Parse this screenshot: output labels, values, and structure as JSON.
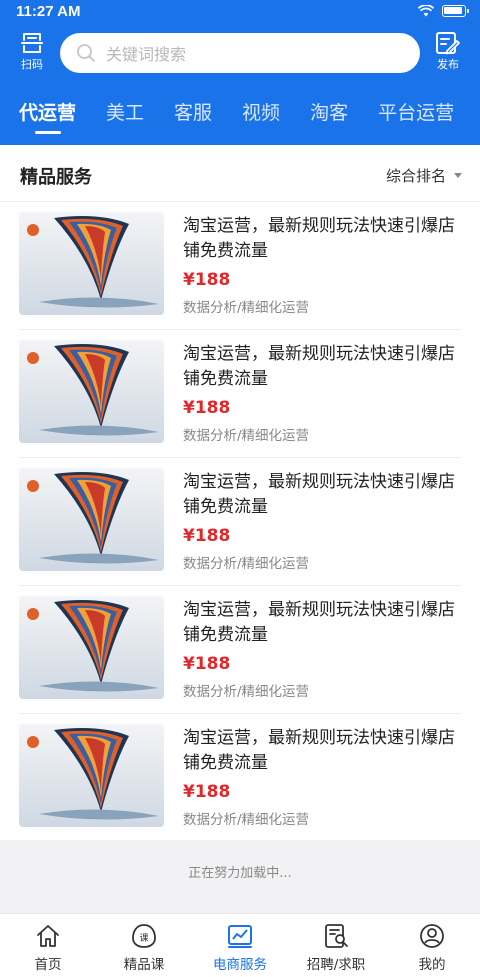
{
  "status_bar": {
    "time": "11:27 AM"
  },
  "header": {
    "scan_label": "扫码",
    "publish_label": "发布",
    "search": {
      "placeholder": "关键词搜索"
    },
    "tabs": [
      {
        "label": "代运营",
        "active": true
      },
      {
        "label": "美工"
      },
      {
        "label": "客服"
      },
      {
        "label": "视频"
      },
      {
        "label": "淘客"
      },
      {
        "label": "平台运营"
      }
    ]
  },
  "section": {
    "title": "精品服务",
    "sort_label": "综合排名"
  },
  "items": [
    {
      "title": "淘宝运营，最新规则玩法快速引爆店铺免费流量",
      "price": "¥188",
      "tags": "数据分析/精细化运营"
    },
    {
      "title": "淘宝运营，最新规则玩法快速引爆店铺免费流量",
      "price": "¥188",
      "tags": "数据分析/精细化运营"
    },
    {
      "title": "淘宝运营，最新规则玩法快速引爆店铺免费流量",
      "price": "¥188",
      "tags": "数据分析/精细化运营"
    },
    {
      "title": "淘宝运营，最新规则玩法快速引爆店铺免费流量",
      "price": "¥188",
      "tags": "数据分析/精细化运营"
    },
    {
      "title": "淘宝运营，最新规则玩法快速引爆店铺免费流量",
      "price": "¥188",
      "tags": "数据分析/精细化运营"
    }
  ],
  "loading_text": "正在努力加载中...",
  "tabbar": [
    {
      "label": "首页",
      "icon": "home-icon"
    },
    {
      "label": "精品课",
      "icon": "course-icon"
    },
    {
      "label": "电商服务",
      "icon": "ecommerce-icon",
      "active": true
    },
    {
      "label": "招聘/求职",
      "icon": "recruit-icon"
    },
    {
      "label": "我的",
      "icon": "profile-icon"
    }
  ],
  "colors": {
    "primary": "#1a73e8",
    "price": "#e02a2a"
  }
}
